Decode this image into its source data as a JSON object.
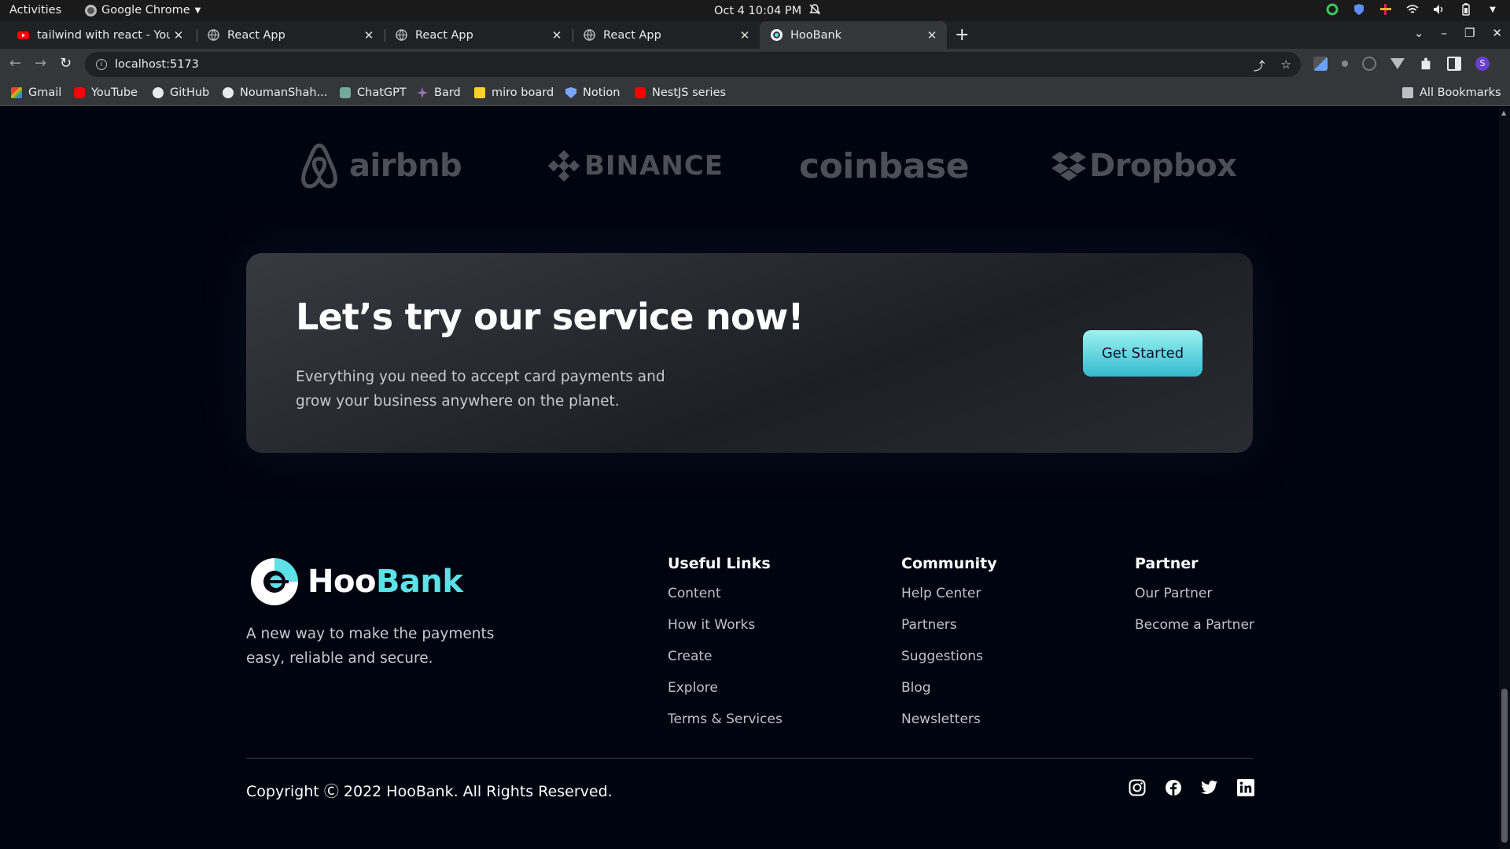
{
  "os": {
    "activities": "Activities",
    "app_name": "Google Chrome",
    "datetime": "Oct 4  10:04 PM"
  },
  "tabs": [
    {
      "title": "tailwind with react - YouT",
      "icon": "youtube-icon"
    },
    {
      "title": "React App",
      "icon": "globe-icon"
    },
    {
      "title": "React App",
      "icon": "globe-icon"
    },
    {
      "title": "React App",
      "icon": "globe-icon"
    },
    {
      "title": "HooBank",
      "icon": "hoobank-icon",
      "active": true
    }
  ],
  "address_bar": {
    "url": "localhost:5173"
  },
  "bookmarks": [
    {
      "label": "Gmail",
      "icon": "gmail-icon"
    },
    {
      "label": "YouTube",
      "icon": "youtube-icon"
    },
    {
      "label": "GitHub",
      "icon": "github-icon"
    },
    {
      "label": "NoumanShah...",
      "icon": "github-icon"
    },
    {
      "label": "ChatGPT",
      "icon": "chatgpt-icon"
    },
    {
      "label": "Bard",
      "icon": "bard-icon"
    },
    {
      "label": "miro board",
      "icon": "miro-icon"
    },
    {
      "label": "Notion",
      "icon": "shield-icon"
    },
    {
      "label": "NestJS series",
      "icon": "youtube-icon"
    }
  ],
  "all_bookmarks": "All Bookmarks",
  "clients": [
    "airbnb",
    "BINANCE",
    "coinbase",
    "Dropbox"
  ],
  "cta": {
    "heading": "Let’s try our service now!",
    "text": "Everything you need to accept card payments and grow your business anywhere on the planet.",
    "button": "Get Started"
  },
  "footer": {
    "brand_prefix": "Hoo",
    "brand_suffix": "Bank",
    "tagline": "A new way to make the payments easy, reliable and secure.",
    "columns": [
      {
        "title": "Useful Links",
        "links": [
          "Content",
          "How it Works",
          "Create",
          "Explore",
          "Terms & Services"
        ]
      },
      {
        "title": "Community",
        "links": [
          "Help Center",
          "Partners",
          "Suggestions",
          "Blog",
          "Newsletters"
        ]
      },
      {
        "title": "Partner",
        "links": [
          "Our Partner",
          "Become a Partner"
        ]
      }
    ],
    "copyright": "Copyright Ⓒ 2022 HooBank. All Rights Reserved.",
    "socials": [
      "instagram-icon",
      "facebook-icon",
      "twitter-icon",
      "linkedin-icon"
    ]
  },
  "colors": {
    "background": "#00040f",
    "accent": "#5ce1e6",
    "button_gradient_start": "#9cf2ef",
    "button_gradient_end": "#33bbcf"
  }
}
